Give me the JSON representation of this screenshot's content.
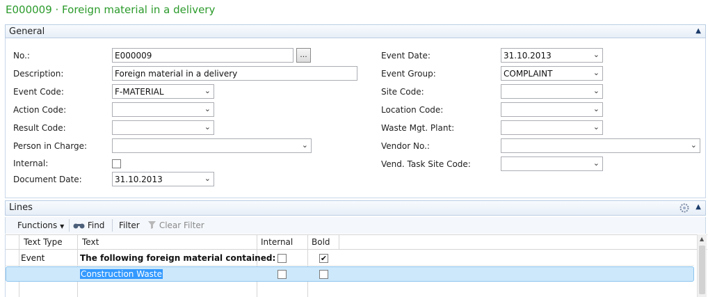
{
  "page_title": "E000009 · Foreign material in a delivery",
  "general": {
    "header": "General",
    "fields_left": [
      {
        "label": "No.:",
        "value": "E000009",
        "kind": "text-ellipsis"
      },
      {
        "label": "Description:",
        "value": "Foreign material in a delivery",
        "kind": "text"
      },
      {
        "label": "Event Code:",
        "value": "F-MATERIAL",
        "kind": "dropdown"
      },
      {
        "label": "Action Code:",
        "value": "",
        "kind": "dropdown"
      },
      {
        "label": "Result Code:",
        "value": "",
        "kind": "dropdown"
      },
      {
        "label": "Person in Charge:",
        "value": "",
        "kind": "dropdown"
      },
      {
        "label": "Internal:",
        "value": "",
        "kind": "checkbox"
      },
      {
        "label": "Document Date:",
        "value": "31.10.2013",
        "kind": "dropdown"
      }
    ],
    "fields_right": [
      {
        "label": "Event Date:",
        "value": "31.10.2013",
        "kind": "dropdown"
      },
      {
        "label": "Event Group:",
        "value": "COMPLAINT",
        "kind": "dropdown"
      },
      {
        "label": "Site Code:",
        "value": "",
        "kind": "dropdown"
      },
      {
        "label": "Location Code:",
        "value": "",
        "kind": "dropdown"
      },
      {
        "label": "Waste Mgt. Plant:",
        "value": "",
        "kind": "dropdown"
      },
      {
        "label": "Vendor No.:",
        "value": "",
        "kind": "dropdown"
      },
      {
        "label": "Vend. Task Site Code:",
        "value": "",
        "kind": "dropdown"
      }
    ],
    "ellipsis_label": "..."
  },
  "lines": {
    "header": "Lines",
    "toolbar": {
      "functions": "Functions",
      "find": "Find",
      "filter": "Filter",
      "clear_filter": "Clear Filter"
    },
    "columns": [
      "Text Type",
      "Text",
      "Internal",
      "Bold"
    ],
    "rows": [
      {
        "text_type": "Event",
        "text": "The following foreign material contained:",
        "internal": false,
        "bold": true
      },
      {
        "text_type": "",
        "text": "Construction Waste",
        "internal": false,
        "bold": false
      }
    ]
  },
  "colors": {
    "title_green": "#2a9a2a",
    "selection_blue": "#cde8fb",
    "selected_text_bg": "#3399ff"
  },
  "icons": {
    "collapse": "chevron-up-icon",
    "dropdown": "chevron-down-icon",
    "find": "binoculars-icon",
    "clear_filter": "funnel-icon",
    "settings": "gear-icon"
  }
}
